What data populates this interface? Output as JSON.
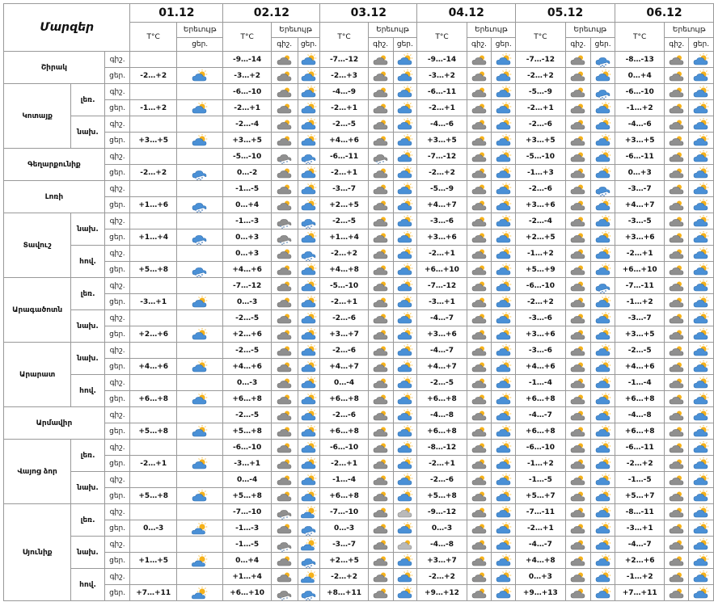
{
  "header": {
    "region_title": "Մարզեր",
    "temp_label": "T°C",
    "phenomenon_label": "Երեւույթ",
    "night_label": "գիշ.",
    "day_label": "ցեր.",
    "dates": [
      "01.12",
      "02.12",
      "03.12",
      "04.12",
      "05.12",
      "06.12"
    ]
  },
  "icon_legend": {
    "s": "sunny-cloud-icon",
    "c": "cloudy-icon",
    "n": "snow-cloud-icon",
    "q": "sleet-cloud-icon",
    "r": "rain-cloud-icon",
    "f": "fog-cloud-icon"
  },
  "regions": [
    {
      "name": "Շիրակ",
      "parts": [
        {
          "name": "",
          "night": {
            "first": "",
            "temps": [
              "-9…-14",
              "-7…-12",
              "-9…-14",
              "-7…-12",
              "-8…-13"
            ],
            "icons": [
              "",
              "c",
              "c",
              "c",
              "c",
              "c"
            ],
            "icons2": [
              "",
              "s",
              "s",
              "s",
              "n",
              "s"
            ]
          },
          "day": {
            "first": "-2…+2",
            "temps": [
              "-3…+2",
              "-2…+3",
              "-3…+2",
              "-2…+2",
              "0…+4"
            ],
            "icons": [
              "s",
              "c",
              "c",
              "c",
              "c",
              "c"
            ],
            "icons2": [
              "",
              "s",
              "s",
              "s",
              "s",
              "s"
            ]
          }
        }
      ]
    },
    {
      "name": "Կոտայք",
      "parts": [
        {
          "name": "լեռ.",
          "night": {
            "first": "",
            "temps": [
              "-6…-10",
              "-4…-9",
              "-6…-11",
              "-5…-9",
              "-6…-10"
            ],
            "icons": [
              "",
              "c",
              "c",
              "c",
              "c",
              "c"
            ],
            "icons2": [
              "",
              "s",
              "s",
              "s",
              "n",
              "s"
            ]
          },
          "day": {
            "first": "-1…+2",
            "temps": [
              "-2…+1",
              "-2…+1",
              "-2…+1",
              "-2…+1",
              "-1…+2"
            ],
            "icons": [
              "s",
              "c",
              "c",
              "c",
              "c",
              "c"
            ],
            "icons2": [
              "",
              "s",
              "s",
              "s",
              "s",
              "s"
            ]
          }
        },
        {
          "name": "նախ.",
          "night": {
            "first": "",
            "temps": [
              "-2…-4",
              "-2…-5",
              "-4…-6",
              "-2…-6",
              "-4…-6"
            ],
            "icons": [
              "",
              "c",
              "c",
              "c",
              "c",
              "c"
            ],
            "icons2": [
              "",
              "s",
              "s",
              "s",
              "s",
              "s"
            ]
          },
          "day": {
            "first": "+3…+5",
            "temps": [
              "+3…+5",
              "+4…+6",
              "+3…+5",
              "+3…+5",
              "+3…+5"
            ],
            "icons": [
              "s",
              "c",
              "c",
              "c",
              "c",
              "c"
            ],
            "icons2": [
              "",
              "s",
              "s",
              "s",
              "s",
              "s"
            ]
          }
        }
      ]
    },
    {
      "name": "Գեղարքունիք",
      "parts": [
        {
          "name": "",
          "night": {
            "first": "",
            "temps": [
              "-5…-10",
              "-6…-11",
              "-7…-12",
              "-5…-10",
              "-6…-11"
            ],
            "icons": [
              "",
              "q",
              "q",
              "c",
              "c",
              "c"
            ],
            "icons2": [
              "",
              "n",
              "s",
              "s",
              "s",
              "s"
            ]
          },
          "day": {
            "first": "-2…+2",
            "temps": [
              "0…-2",
              "-2…+1",
              "-2…+2",
              "-1…+3",
              "0…+3"
            ],
            "icons": [
              "n",
              "c",
              "c",
              "c",
              "c",
              "c"
            ],
            "icons2": [
              "",
              "s",
              "s",
              "s",
              "s",
              "s"
            ]
          }
        }
      ]
    },
    {
      "name": "Լոռի",
      "parts": [
        {
          "name": "",
          "night": {
            "first": "",
            "temps": [
              "-1…-5",
              "-3…-7",
              "-5…-9",
              "-2…-6",
              "-3…-7"
            ],
            "icons": [
              "",
              "c",
              "c",
              "c",
              "c",
              "c"
            ],
            "icons2": [
              "",
              "s",
              "s",
              "s",
              "n",
              "s"
            ]
          },
          "day": {
            "first": "+1…+6",
            "temps": [
              "0…+4",
              "+2…+5",
              "+4…+7",
              "+3…+6",
              "+4…+7"
            ],
            "icons": [
              "n",
              "c",
              "c",
              "c",
              "c",
              "c"
            ],
            "icons2": [
              "",
              "s",
              "s",
              "s",
              "s",
              "s"
            ]
          }
        }
      ]
    },
    {
      "name": "Տավուշ",
      "parts": [
        {
          "name": "նախ.",
          "night": {
            "first": "",
            "temps": [
              "-1…-3",
              "-2…-5",
              "-3…-6",
              "-2…-4",
              "-3…-5"
            ],
            "icons": [
              "",
              "q",
              "c",
              "c",
              "c",
              "c"
            ],
            "icons2": [
              "",
              "n",
              "s",
              "s",
              "s",
              "s"
            ]
          },
          "day": {
            "first": "+1…+4",
            "temps": [
              "0…+3",
              "+1…+4",
              "+3…+6",
              "+2…+5",
              "+3…+6"
            ],
            "icons": [
              "n",
              "q",
              "c",
              "c",
              "c",
              "c"
            ],
            "icons2": [
              "",
              "s",
              "s",
              "s",
              "s",
              "s"
            ]
          }
        },
        {
          "name": "հով.",
          "night": {
            "first": "",
            "temps": [
              "0…+3",
              "-2…+2",
              "-2…+1",
              "-1…+2",
              "-2…+1"
            ],
            "icons": [
              "",
              "c",
              "c",
              "c",
              "c",
              "c"
            ],
            "icons2": [
              "",
              "n",
              "s",
              "s",
              "s",
              "s"
            ]
          },
          "day": {
            "first": "+5…+8",
            "temps": [
              "+4…+6",
              "+4…+8",
              "+6…+10",
              "+5…+9",
              "+6…+10"
            ],
            "icons": [
              "n",
              "c",
              "c",
              "c",
              "c",
              "c"
            ],
            "icons2": [
              "",
              "s",
              "s",
              "s",
              "s",
              "s"
            ]
          }
        }
      ]
    },
    {
      "name": "Արագածոտն",
      "parts": [
        {
          "name": "լեռ.",
          "night": {
            "first": "",
            "temps": [
              "-7…-12",
              "-5…-10",
              "-7…-12",
              "-6…-10",
              "-7…-11"
            ],
            "icons": [
              "",
              "c",
              "c",
              "c",
              "c",
              "c"
            ],
            "icons2": [
              "",
              "s",
              "s",
              "s",
              "n",
              "s"
            ]
          },
          "day": {
            "first": "-3…+1",
            "temps": [
              "0…-3",
              "-2…+1",
              "-3…+1",
              "-2…+2",
              "-1…+2"
            ],
            "icons": [
              "s",
              "c",
              "c",
              "c",
              "c",
              "c"
            ],
            "icons2": [
              "",
              "s",
              "s",
              "s",
              "s",
              "s"
            ]
          }
        },
        {
          "name": "նախ.",
          "night": {
            "first": "",
            "temps": [
              "-2…-5",
              "-2…-6",
              "-4…-7",
              "-3…-6",
              "-3…-7"
            ],
            "icons": [
              "",
              "c",
              "c",
              "c",
              "c",
              "c"
            ],
            "icons2": [
              "",
              "s",
              "s",
              "s",
              "s",
              "s"
            ]
          },
          "day": {
            "first": "+2…+6",
            "temps": [
              "+2…+6",
              "+3…+7",
              "+3…+6",
              "+3…+6",
              "+3…+5"
            ],
            "icons": [
              "s",
              "c",
              "c",
              "c",
              "c",
              "c"
            ],
            "icons2": [
              "",
              "s",
              "s",
              "s",
              "s",
              "s"
            ]
          }
        }
      ]
    },
    {
      "name": "Արարատ",
      "parts": [
        {
          "name": "նախ.",
          "night": {
            "first": "",
            "temps": [
              "-2…-5",
              "-2…-6",
              "-4…-7",
              "-3…-6",
              "-2…-5"
            ],
            "icons": [
              "",
              "c",
              "c",
              "c",
              "c",
              "c"
            ],
            "icons2": [
              "",
              "s",
              "s",
              "s",
              "s",
              "s"
            ]
          },
          "day": {
            "first": "+4…+6",
            "temps": [
              "+4…+6",
              "+4…+7",
              "+4…+7",
              "+4…+6",
              "+4…+6"
            ],
            "icons": [
              "s",
              "c",
              "c",
              "c",
              "c",
              "c"
            ],
            "icons2": [
              "",
              "s",
              "s",
              "s",
              "s",
              "s"
            ]
          }
        },
        {
          "name": "հով.",
          "night": {
            "first": "",
            "temps": [
              "0…-3",
              "0…-4",
              "-2…-5",
              "-1…-4",
              "-1…-4"
            ],
            "icons": [
              "",
              "c",
              "c",
              "c",
              "c",
              "c"
            ],
            "icons2": [
              "",
              "s",
              "s",
              "s",
              "s",
              "s"
            ]
          },
          "day": {
            "first": "+6…+8",
            "temps": [
              "+6…+8",
              "+6…+8",
              "+6…+8",
              "+6…+8",
              "+6…+8"
            ],
            "icons": [
              "s",
              "c",
              "c",
              "c",
              "c",
              "c"
            ],
            "icons2": [
              "",
              "s",
              "s",
              "s",
              "s",
              "s"
            ]
          }
        }
      ]
    },
    {
      "name": "Արմավիր",
      "parts": [
        {
          "name": "",
          "night": {
            "first": "",
            "temps": [
              "-2…-5",
              "-2…-6",
              "-4…-8",
              "-4…-7",
              "-4…-8"
            ],
            "icons": [
              "",
              "c",
              "c",
              "c",
              "c",
              "c"
            ],
            "icons2": [
              "",
              "s",
              "s",
              "s",
              "s",
              "s"
            ]
          },
          "day": {
            "first": "+5…+8",
            "temps": [
              "+5…+8",
              "+6…+8",
              "+6…+8",
              "+6…+8",
              "+6…+8"
            ],
            "icons": [
              "s",
              "c",
              "c",
              "c",
              "c",
              "c"
            ],
            "icons2": [
              "",
              "s",
              "s",
              "s",
              "s",
              "s"
            ]
          }
        }
      ]
    },
    {
      "name": "Վայոց ձոր",
      "parts": [
        {
          "name": "լեռ.",
          "night": {
            "first": "",
            "temps": [
              "-6…-10",
              "-6…-10",
              "-8…-12",
              "-6…-10",
              "-6…-11"
            ],
            "icons": [
              "",
              "c",
              "c",
              "c",
              "c",
              "c"
            ],
            "icons2": [
              "",
              "s",
              "s",
              "s",
              "s",
              "s"
            ]
          },
          "day": {
            "first": "-2…+1",
            "temps": [
              "-3…+1",
              "-2…+1",
              "-2…+1",
              "-1…+2",
              "-2…+2"
            ],
            "icons": [
              "s",
              "c",
              "c",
              "c",
              "c",
              "c"
            ],
            "icons2": [
              "",
              "s",
              "s",
              "s",
              "s",
              "s"
            ]
          }
        },
        {
          "name": "նախ.",
          "night": {
            "first": "",
            "temps": [
              "0…-4",
              "-1…-4",
              "-2…-6",
              "-1…-5",
              "-1…-5"
            ],
            "icons": [
              "",
              "c",
              "c",
              "c",
              "c",
              "c"
            ],
            "icons2": [
              "",
              "s",
              "s",
              "s",
              "s",
              "s"
            ]
          },
          "day": {
            "first": "+5…+8",
            "temps": [
              "+5…+8",
              "+6…+8",
              "+5…+8",
              "+5…+7",
              "+5…+7"
            ],
            "icons": [
              "s",
              "c",
              "c",
              "c",
              "c",
              "c"
            ],
            "icons2": [
              "",
              "s",
              "s",
              "s",
              "s",
              "s"
            ]
          }
        }
      ]
    },
    {
      "name": "Սյունիք",
      "parts": [
        {
          "name": "լեռ.",
          "night": {
            "first": "",
            "temps": [
              "-7…-10",
              "-7…-10",
              "-9…-12",
              "-7…-11",
              "-8…-11"
            ],
            "icons": [
              "",
              "q",
              "c",
              "c",
              "c",
              "c"
            ],
            "icons2": [
              "",
              "r",
              "f",
              "s",
              "s",
              "s"
            ]
          },
          "day": {
            "first": "0…-3",
            "temps": [
              "-1…-3",
              "0…-3",
              "0…-3",
              "-2…+1",
              "-3…+1"
            ],
            "icons": [
              "r",
              "c",
              "c",
              "c",
              "c",
              "c"
            ],
            "icons2": [
              "",
              "n",
              "s",
              "s",
              "s",
              "s"
            ]
          }
        },
        {
          "name": "նախ.",
          "night": {
            "first": "",
            "temps": [
              "-1…-5",
              "-3…-7",
              "-4…-8",
              "-4…-7",
              "-4…-7"
            ],
            "icons": [
              "",
              "q",
              "c",
              "c",
              "c",
              "c"
            ],
            "icons2": [
              "",
              "r",
              "f",
              "s",
              "s",
              "s"
            ]
          },
          "day": {
            "first": "+1…+5",
            "temps": [
              "0…+4",
              "+2…+5",
              "+3…+7",
              "+4…+8",
              "+2…+6"
            ],
            "icons": [
              "r",
              "c",
              "c",
              "c",
              "c",
              "c"
            ],
            "icons2": [
              "",
              "n",
              "s",
              "s",
              "s",
              "s"
            ]
          }
        },
        {
          "name": "հով.",
          "night": {
            "first": "",
            "temps": [
              "+1…+4",
              "-2…+2",
              "-2…+2",
              "0…+3",
              "-1…+2"
            ],
            "icons": [
              "",
              "c",
              "c",
              "c",
              "c",
              "c"
            ],
            "icons2": [
              "",
              "r",
              "s",
              "s",
              "s",
              "s"
            ]
          },
          "day": {
            "first": "+7…+11",
            "temps": [
              "+6…+10",
              "+8…+11",
              "+9…+12",
              "+9…+13",
              "+7…+11"
            ],
            "icons": [
              "r",
              "q",
              "c",
              "c",
              "c",
              "c"
            ],
            "icons2": [
              "",
              "n",
              "s",
              "s",
              "s",
              "s"
            ]
          }
        }
      ]
    }
  ]
}
